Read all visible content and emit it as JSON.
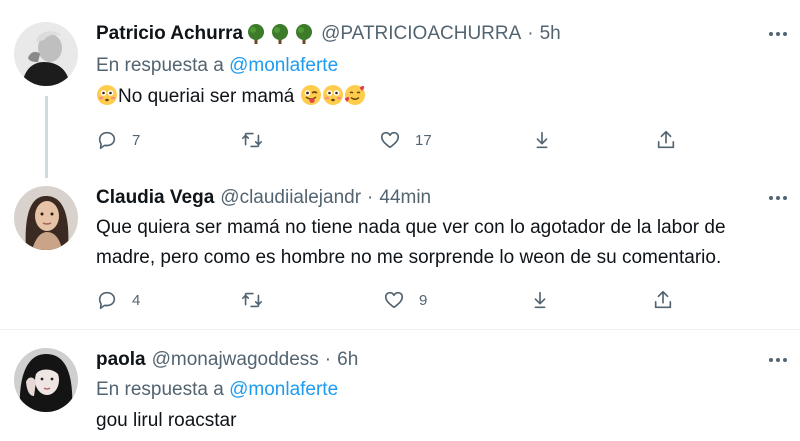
{
  "tweets": [
    {
      "name": "Patricio Achurra",
      "badge_icons": [
        "tree-icon",
        "tree-icon",
        "tree-icon"
      ],
      "handle": "@PATRICIOACHURRA",
      "dot": "·",
      "time": "5h",
      "reply_prefix": "En respuesta a",
      "reply_mention": "@monlaferte",
      "text": "No queriai ser mamá",
      "actions": {
        "replies": "7",
        "retweets": "",
        "likes": "17"
      }
    },
    {
      "name": "Claudia Vega",
      "handle": "@claudiialejandr",
      "dot": "·",
      "time": "44min",
      "text_lines": [
        "Que quiera ser mamá no tiene nada que ver con lo agotador de la labor de",
        "madre, pero como es hombre no me sorprende lo weon de su comentario."
      ],
      "actions": {
        "replies": "4",
        "retweets": "",
        "likes": "9"
      }
    },
    {
      "name": "paola",
      "handle": "@monajwagoddess",
      "dot": "·",
      "time": "6h",
      "reply_prefix": "En respuesta a",
      "reply_mention": "@monlaferte",
      "text": "gou lirul roacstar"
    }
  ],
  "colors": {
    "text": "#0f1419",
    "secondary": "#536471",
    "link": "#1d9bf0",
    "thread_line": "#cfd9de",
    "divider": "#eff3f4"
  }
}
